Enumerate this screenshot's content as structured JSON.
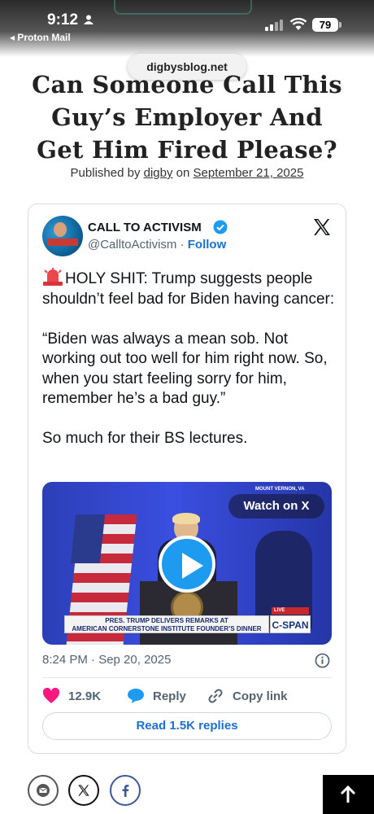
{
  "status_bar": {
    "time": "9:12",
    "back_app": "◂ Proton Mail",
    "battery": "79"
  },
  "browser": {
    "url": "digbysblog.net"
  },
  "article": {
    "title_lines": [
      "Can Someone Call This",
      "Guy’s Employer And",
      "Get Him Fired Please?"
    ],
    "published_prefix": "Published by",
    "author": "digby",
    "on": "on",
    "date": "September 21, 2025"
  },
  "tweet": {
    "account_name": "CALL TO ACTIVISM",
    "handle": "@CalltoActivism",
    "dot": "·",
    "follow": "Follow",
    "paragraphs": [
      "HOLY SHIT: Trump suggests people shouldn’t feel bad for Biden having cancer:",
      "“Biden was always a mean sob. Not working out too well for him right now. So, when you start feeling sorry for him, remember he’s a bad guy.”",
      "So much for their BS lectures."
    ],
    "video": {
      "watch_label": "Watch on X",
      "location": "MOUNT VERNON, VA",
      "chyron_line1": "PRES. TRUMP DELIVERS REMARKS AT",
      "chyron_line2": "AMERICAN CORNERSTONE INSTITUTE FOUNDER’S DINNER",
      "live": "LIVE",
      "network": "C-SPAN"
    },
    "timestamp": "8:24 PM · Sep 20, 2025",
    "likes": "12.9K",
    "reply_label": "Reply",
    "copy_link_label": "Copy link",
    "read_replies": "Read 1.5K replies",
    "colors": {
      "link_blue": "#1d6fd1",
      "verified": "#1d9bf0",
      "like_pink": "#f91880"
    }
  },
  "share_icons": [
    "email-icon",
    "x-icon",
    "facebook-icon"
  ],
  "back_to_top_icon": "arrow-up-icon"
}
